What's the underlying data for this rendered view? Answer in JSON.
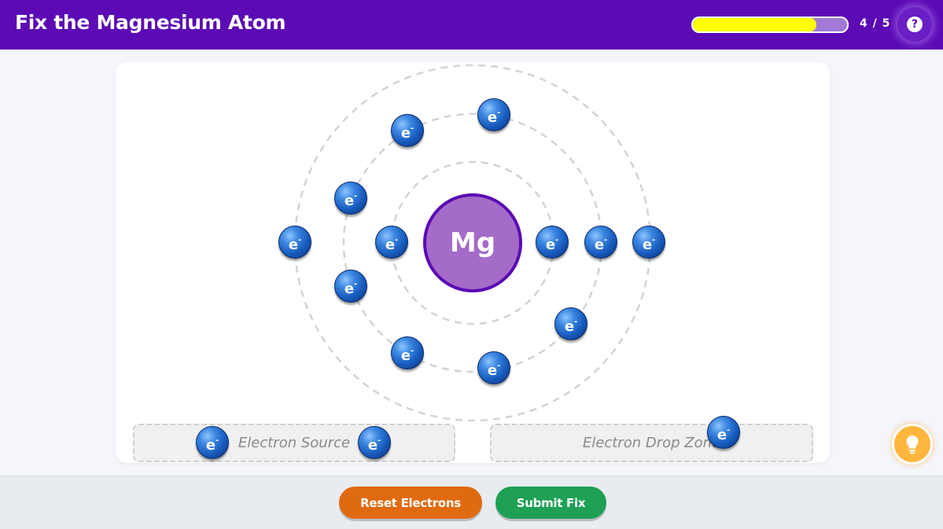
{
  "header": {
    "title": "Fix the Magnesium Atom",
    "progress_text": "4 / 5",
    "progress_fraction": 0.8,
    "help_symbol": "?"
  },
  "atom": {
    "nucleus_label": "Mg",
    "electron_label": "e",
    "electron_charge": "-"
  },
  "zones": {
    "source_label": "Electron Source",
    "drop_label": "Electron Drop Zone"
  },
  "buttons": {
    "reset_label": "Reset Electrons",
    "submit_label": "Submit Fix"
  },
  "colors": {
    "header": "#5b0ab4",
    "progress_fill": "#ffff00",
    "nucleus": "#a46bc9",
    "reset": "#e06a10",
    "submit": "#1ea055",
    "hint": "#ffb63d"
  },
  "icons": {
    "help": "question-icon",
    "hint": "lightbulb-icon"
  }
}
